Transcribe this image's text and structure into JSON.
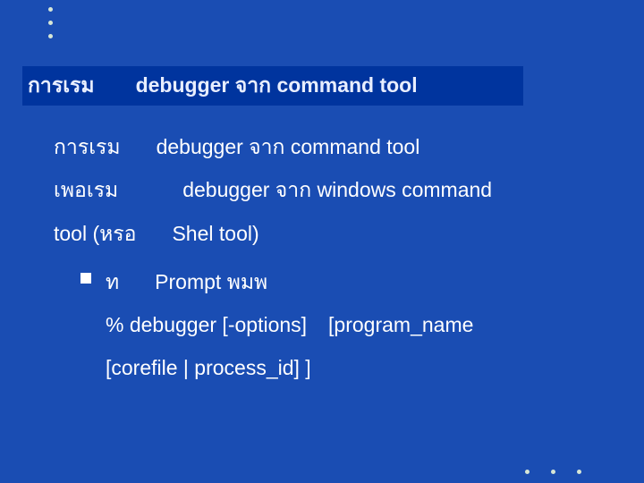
{
  "title": {
    "part1": "การเรม",
    "part2": "debugger จาก command tool"
  },
  "lines": {
    "l1a": "การเรม",
    "l1b": "debugger จาก command tool",
    "l2a": "เพอเรม",
    "l2b": "debugger จาก windows command",
    "l3a": "tool (หรอ",
    "l3b": "Shel tool)",
    "bullet_a": "ท",
    "bullet_b": "Prompt พมพ",
    "cmd1a": "% debugger [-options]",
    "cmd1b": "[program_name",
    "cmd2": "[corefile | process_id]  ]"
  }
}
